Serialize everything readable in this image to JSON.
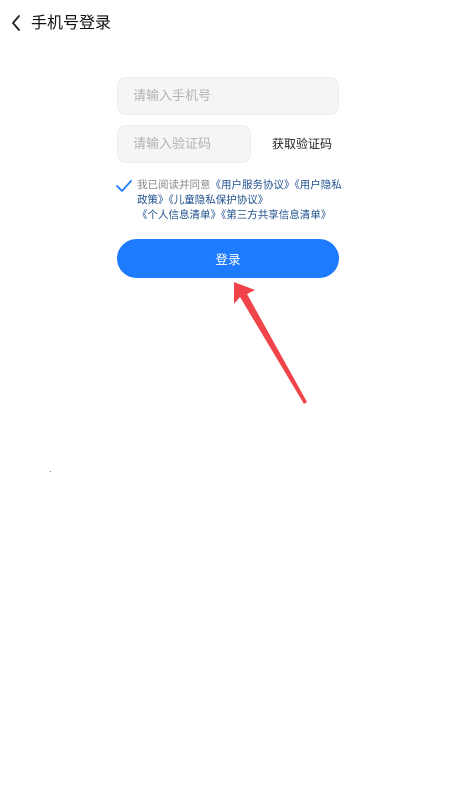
{
  "header": {
    "back_icon": "chevron-left-icon",
    "title": "手机号登录"
  },
  "form": {
    "phone_placeholder": "请输入手机号",
    "code_placeholder": "请输入验证码",
    "get_code_label": "获取验证码",
    "agreement": {
      "checked": true,
      "prefix": "我已阅读并同意",
      "links": [
        "《用户服务协议》",
        "《用户隐私政策》",
        "《儿童隐私保护协议》",
        "《个人信息清单》",
        "《第三方共享信息清单》"
      ]
    },
    "login_label": "登录"
  },
  "colors": {
    "primary": "#1c7bff",
    "link": "#1e4f8c",
    "annotation_arrow": "#f0444a"
  }
}
